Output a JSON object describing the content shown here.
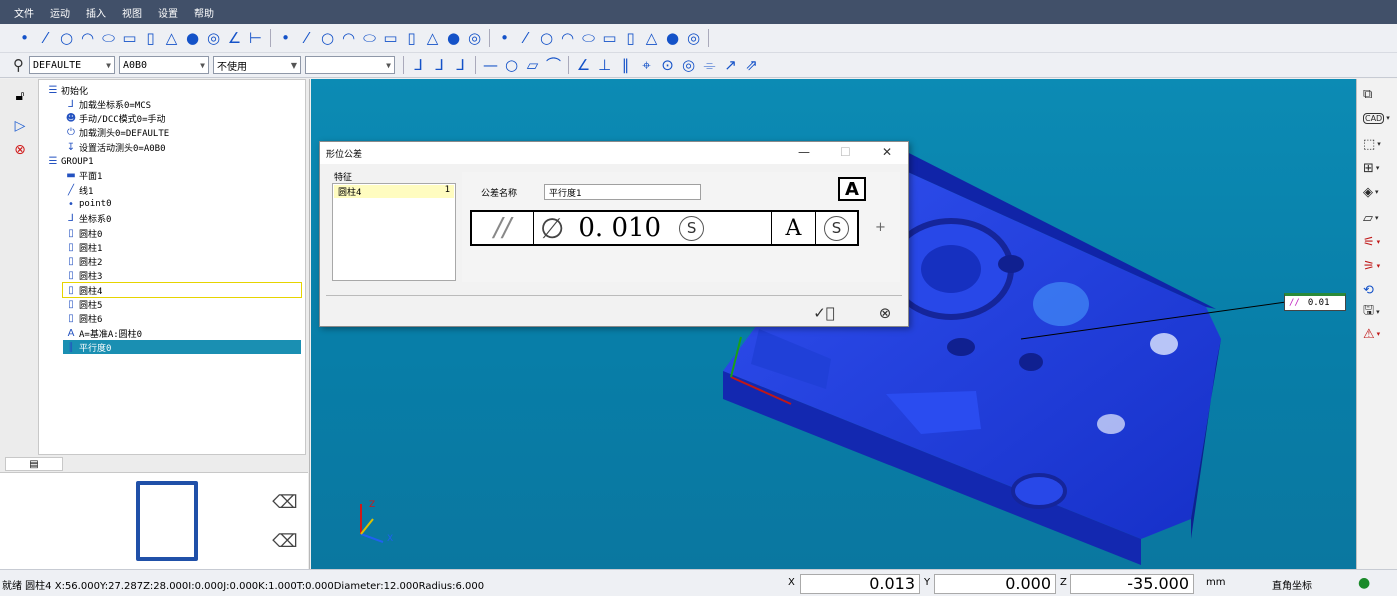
{
  "menu": [
    "文件",
    "运动",
    "插入",
    "视图",
    "设置",
    "帮助"
  ],
  "toolbar2": {
    "probe_value": "DEFAULTE",
    "tip_value": "A0B0",
    "mode_value": "不使用",
    "blank_value": ""
  },
  "tree": {
    "nodes": [
      {
        "label": "初始化",
        "level": 0,
        "icon": "list-icon"
      },
      {
        "label": "加载坐标系0=MCS",
        "level": 1,
        "icon": "axes-icon"
      },
      {
        "label": "手动/DCC模式0=手动",
        "level": 1,
        "icon": "person-icon"
      },
      {
        "label": "加载测头0=DEFAULTE",
        "level": 1,
        "icon": "power-icon"
      },
      {
        "label": "设置活动测头0=A0B0",
        "level": 1,
        "icon": "probe-icon"
      },
      {
        "label": "GROUP1",
        "level": 0,
        "icon": "list-icon"
      },
      {
        "label": "平面1",
        "level": 1,
        "icon": "plane-icon"
      },
      {
        "label": "线1",
        "level": 1,
        "icon": "line-icon"
      },
      {
        "label": "point0",
        "level": 1,
        "icon": "point-icon"
      },
      {
        "label": "坐标系0",
        "level": 1,
        "icon": "axes-icon"
      },
      {
        "label": "圆柱0",
        "level": 1,
        "icon": "cylinder-icon"
      },
      {
        "label": "圆柱1",
        "level": 1,
        "icon": "cylinder-icon"
      },
      {
        "label": "圆柱2",
        "level": 1,
        "icon": "cylinder-icon"
      },
      {
        "label": "圆柱3",
        "level": 1,
        "icon": "cylinder-icon"
      },
      {
        "label": "圆柱4",
        "level": 1,
        "icon": "cylinder-icon"
      },
      {
        "label": "圆柱5",
        "level": 1,
        "icon": "cylinder-icon"
      },
      {
        "label": "圆柱6",
        "level": 1,
        "icon": "cylinder-icon"
      },
      {
        "label": "A=基准A:圆柱0",
        "level": 1,
        "icon": "datum-icon"
      },
      {
        "label": "平行度0",
        "level": 1,
        "icon": "parallel-icon"
      }
    ],
    "highlighted_index": 14,
    "selected_index": 18
  },
  "dialog": {
    "title": "形位公差",
    "feature_label": "特征",
    "feature_item": "圆柱4",
    "feature_count": "1",
    "tol_name_label": "公差名称",
    "tol_name_value": "平行度1",
    "datum_badge": "A",
    "frame": {
      "symbol": "//",
      "diameter": "∅",
      "value": "0. 010",
      "modifier": "S",
      "datum": "A",
      "datum_modifier": "S"
    },
    "plus": "+",
    "minimize": "—",
    "maximize": "☐",
    "close": "✕"
  },
  "annotation": {
    "symbol": "//",
    "value": "0.01"
  },
  "axes": {
    "z": "Z",
    "y": "Y",
    "x": "X"
  },
  "status": {
    "text": "就绪 圆柱4  X:56.000Y:27.287Z:28.000I:0.000J:0.000K:1.000T:0.000Diameter:12.000Radius:6.000",
    "x_label": "X",
    "x_value": "0.013",
    "y_label": "Y",
    "y_value": "0.000",
    "z_label": "Z",
    "z_value": "-35.000",
    "unit": "mm",
    "coord_mode": "直角坐标"
  },
  "colors": {
    "menubar": "#415069",
    "viewport": "#0c8bb4",
    "part": "#1f3fe0",
    "selected": "#1a8fb2"
  }
}
